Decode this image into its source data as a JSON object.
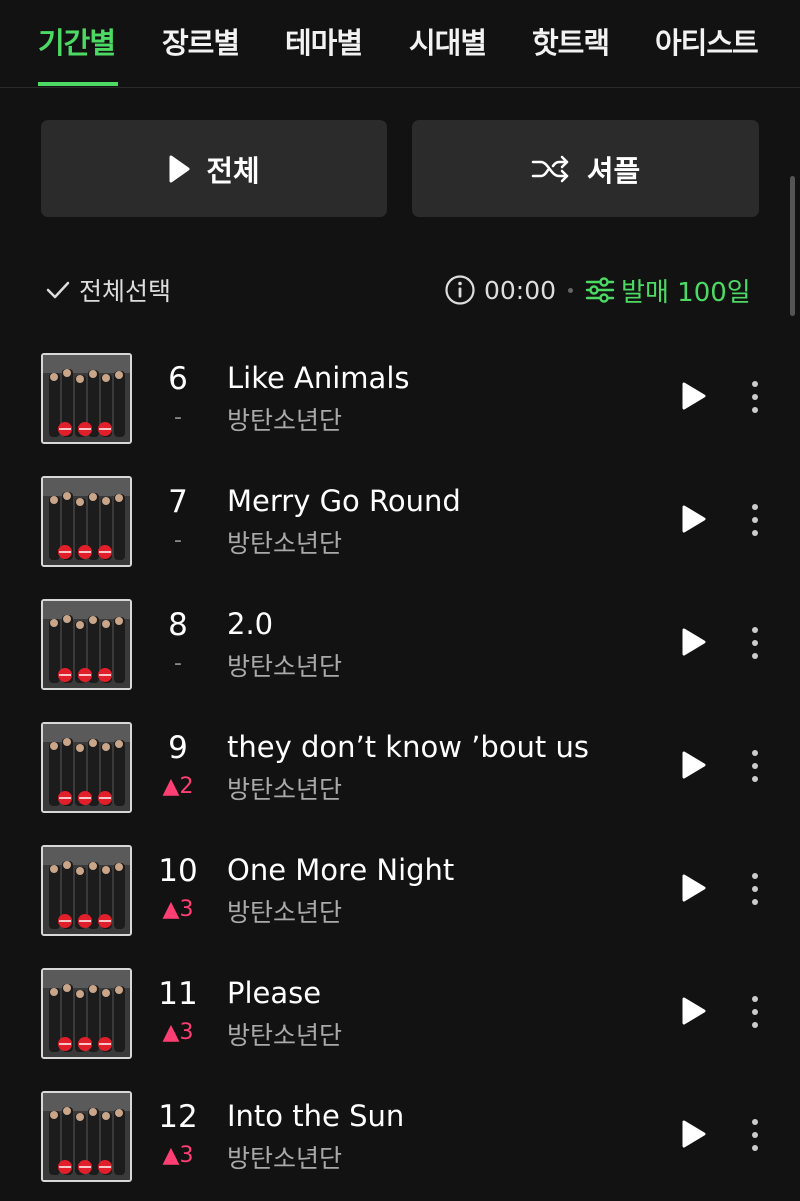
{
  "tabs": [
    {
      "label": "기간별",
      "active": true
    },
    {
      "label": "장르별",
      "active": false
    },
    {
      "label": "테마별",
      "active": false
    },
    {
      "label": "시대별",
      "active": false
    },
    {
      "label": "핫트랙",
      "active": false
    },
    {
      "label": "아티스트",
      "active": false
    }
  ],
  "actions": {
    "play_all": "전체",
    "shuffle": "셔플"
  },
  "controls": {
    "select_all": "전체선택",
    "duration": "00:00",
    "filter": "발매 100일"
  },
  "colors": {
    "accent": "#4cd964",
    "rank_up": "#ff3f73",
    "background": "#121212"
  },
  "tracks": [
    {
      "rank": "6",
      "change": "-",
      "title": "Like Animals",
      "artist": "방탄소년단"
    },
    {
      "rank": "7",
      "change": "-",
      "title": "Merry Go Round",
      "artist": "방탄소년단"
    },
    {
      "rank": "8",
      "change": "-",
      "title": "2.0",
      "artist": "방탄소년단"
    },
    {
      "rank": "9",
      "change": "▲2",
      "title": "they don’t know ’bout us",
      "artist": "방탄소년단"
    },
    {
      "rank": "10",
      "change": "▲3",
      "title": "One More Night",
      "artist": "방탄소년단"
    },
    {
      "rank": "11",
      "change": "▲3",
      "title": "Please",
      "artist": "방탄소년단"
    },
    {
      "rank": "12",
      "change": "▲3",
      "title": "Into the Sun",
      "artist": "방탄소년단"
    }
  ],
  "icons": {
    "play": "play-icon",
    "shuffle": "shuffle-icon",
    "check": "check-icon",
    "info": "info-icon",
    "filter": "sliders-icon",
    "more": "more-vertical-icon",
    "cover": "album-cover"
  }
}
